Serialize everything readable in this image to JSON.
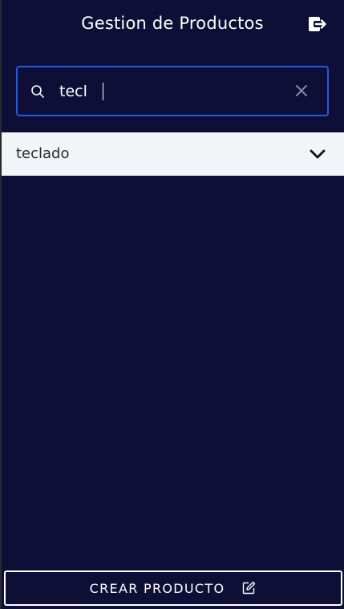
{
  "header": {
    "title": "Gestion de Productos",
    "logout_icon": "logout-icon"
  },
  "search": {
    "value": "tecl",
    "placeholder": "",
    "icon": "search-icon",
    "clear_icon": "close-icon"
  },
  "results": [
    {
      "label": "teclado",
      "icon": "chevron-down-icon"
    }
  ],
  "footer": {
    "create_label": "CREAR PRODUCTO",
    "create_icon": "edit-icon"
  },
  "colors": {
    "background": "#0e0e36",
    "accent": "#1e5be6",
    "result_bg": "#f3f4f8",
    "text": "#ffffff"
  }
}
